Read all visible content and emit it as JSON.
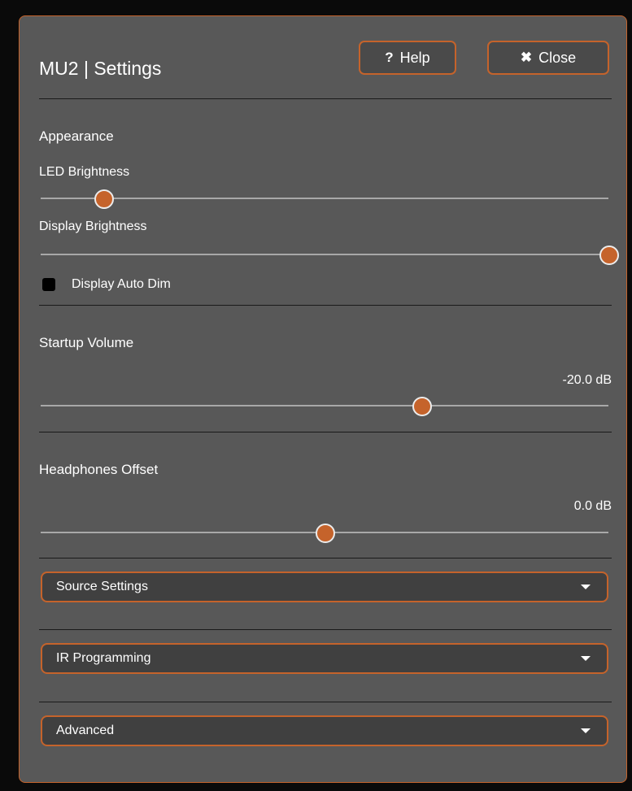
{
  "header": {
    "title": "MU2 | Settings",
    "help": {
      "icon": "question-icon",
      "glyph": "?",
      "label": "Help"
    },
    "close": {
      "icon": "close-icon",
      "glyph": "✖",
      "label": "Close"
    }
  },
  "appearance": {
    "section_label": "Appearance",
    "led_brightness": {
      "label": "LED Brightness",
      "level_percent": 11
    },
    "display_brightness": {
      "label": "Display Brightness",
      "level_percent": 100
    },
    "auto_dim": {
      "label": "Display Auto Dim",
      "checked": false
    }
  },
  "startup_volume": {
    "label": "Startup Volume",
    "value_text": "-20.0 dB",
    "level_percent": 67
  },
  "headphones_offset": {
    "label": "Headphones Offset",
    "value_text": "0.0 dB",
    "level_percent": 50
  },
  "dropdowns": [
    {
      "label": "Source Settings",
      "icon": "caret-down-icon"
    },
    {
      "label": "IR Programming",
      "icon": "caret-down-icon"
    },
    {
      "label": "Advanced",
      "icon": "caret-down-icon"
    }
  ],
  "colors": {
    "accent": "#c5632b",
    "panel_bg": "#585858",
    "page_bg": "#0a0a0a",
    "text": "#ffffff"
  }
}
